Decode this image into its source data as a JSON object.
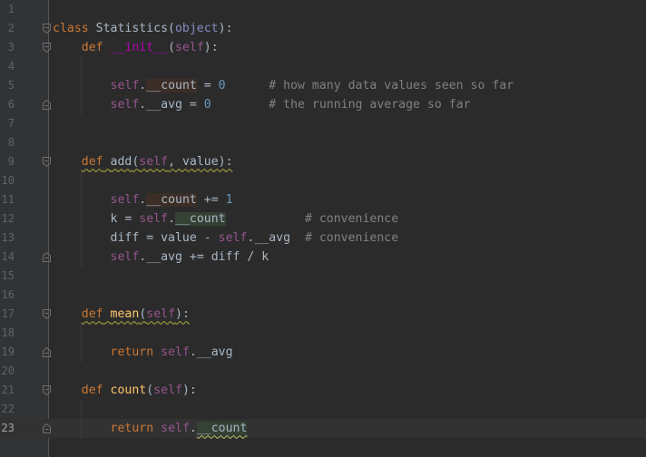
{
  "editor": {
    "language": "python",
    "current_line": 23,
    "lines": [
      {
        "n": "1"
      },
      {
        "n": "2"
      },
      {
        "n": "3"
      },
      {
        "n": "4"
      },
      {
        "n": "5"
      },
      {
        "n": "6"
      },
      {
        "n": "7"
      },
      {
        "n": "8"
      },
      {
        "n": "9"
      },
      {
        "n": "10"
      },
      {
        "n": "11"
      },
      {
        "n": "12"
      },
      {
        "n": "13"
      },
      {
        "n": "14"
      },
      {
        "n": "15"
      },
      {
        "n": "16"
      },
      {
        "n": "17"
      },
      {
        "n": "18"
      },
      {
        "n": "19"
      },
      {
        "n": "20"
      },
      {
        "n": "21"
      },
      {
        "n": "22"
      },
      {
        "n": "23"
      }
    ],
    "tokens": {
      "class_kw": "class",
      "class_name": " Statistics(",
      "object": "object",
      "class_end": "):",
      "def": "def",
      "init": "__init__",
      "self": "self",
      "paren_open": "(",
      "paren_close": "):",
      "dot": ".",
      "count_attr": "__count",
      "avg_attr": "__avg",
      "assign_zero": " = ",
      "zero": "0",
      "comment_count": "# how many data values seen so far",
      "comment_avg": "# the running average so far",
      "add_name": "add",
      "add_args_sep": ", value",
      "plus_eq": " += ",
      "one": "1",
      "k_assign": "k = ",
      "comment_conv": "# convenience",
      "diff_assign": "diff = value - ",
      "diff_tail": " += diff / k",
      "mean_name": "mean",
      "return_kw": "return",
      "count_name": "count"
    }
  }
}
